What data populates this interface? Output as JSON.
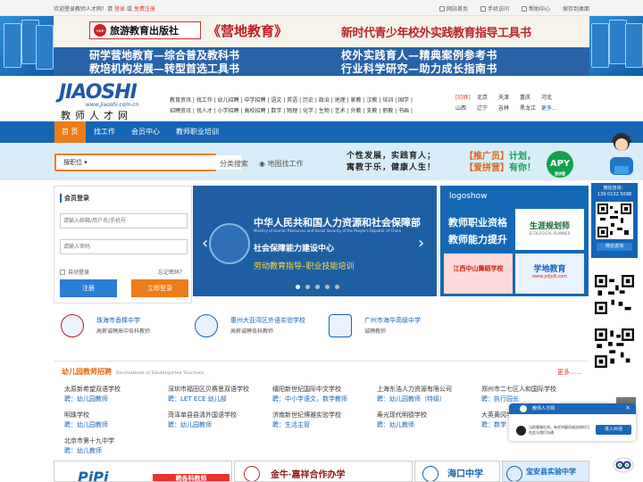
{
  "topbar": {
    "welcome_prefix": "欢迎登录教师人才网！请",
    "login": "登录",
    "or": "或",
    "register": "免费注册",
    "links": [
      "网站首页",
      "手机访问",
      "帮助中心",
      "保存到桌面"
    ]
  },
  "banner": {
    "publisher": "旅游教育出版社",
    "brand": "《营地教育》",
    "slogan": "新时代青少年校外实践教育指导工具书",
    "left_lines": [
      "研学营地教育—综合普及教科书",
      "教培机构发展—转型首选工具书"
    ],
    "right_lines": [
      "校外实践育人—精典案例参考书",
      "行业科学研究—助力成长指南书"
    ]
  },
  "logo": {
    "en": "JIAOSHI",
    "url": "www.jiaoshi.com.cn",
    "cn": "教师人才网"
  },
  "categories": {
    "row1": "教育资讯 | 找工作 | 幼儿招聘 | 中学招聘 | 语文 | 英语 | 历史 | 政治 | 地理 | 家教 | 汉教 | 培训 | 国学 |",
    "row2": "招聘资讯 | 找人才 | 小学招聘 | 高校招聘 | 数学 | 物理 | 化学 | 生物 | 艺术 | 外教 | 支教 | 职教 | 书画 |"
  },
  "cities": {
    "row1": [
      "[切换]",
      "北京",
      "天津",
      "重庆",
      "河北"
    ],
    "row2": [
      "山西",
      "辽宁",
      "吉林",
      "黑龙江",
      "更多..."
    ]
  },
  "nav": [
    "首 页",
    "找工作",
    "会员中心",
    "教师职业培训"
  ],
  "search": {
    "select": "搜职位",
    "placeholder": "",
    "button": "搜索",
    "links": [
      "分类搜索",
      "地图找工作"
    ]
  },
  "slogan": [
    "个性发展，实践育人；",
    "寓教于乐，健康人生！"
  ],
  "promo": {
    "l1_open": "【推广员】",
    "l1_rest": "计划，",
    "l2_open": "【爱拼营】",
    "l2_rest": "有你！",
    "apy": "APY",
    "apy_sub": "爱拼营"
  },
  "login": {
    "title": "会员登录",
    "account_placeholder": "请输入邮箱/用户名/手机号",
    "password_placeholder": "请输入密码",
    "remember": "自动登录",
    "forgot": "忘记密码？",
    "register": "注册",
    "login": "立即登录"
  },
  "slider": {
    "title": "中华人民共和国人力资源和社会保障部",
    "title_en": "Ministry of Human Resources and Social Security of the People's Republic of China",
    "line2": "社会保障能力建设中心",
    "line3": "劳动教育指导–职业技能培训",
    "prev": "‹",
    "next": "›"
  },
  "logoshow": {
    "title": "logoshow",
    "big": [
      "教师职业资格",
      "教师能力提升"
    ],
    "tile1": "生涯规划师",
    "tile1_sub": "ECOLOGICAL PLANNER",
    "tile2": "学地教育",
    "tile2_sub": "www.ydjy8.com",
    "tile3": "江西中山舞蹈学校"
  },
  "schools": [
    {
      "name": "珠海市香樟中学",
      "desc": "高薪诚聘高中各科教师"
    },
    {
      "name": "惠州大亚湾区外语实验学校",
      "desc": "高薪诚聘各科教师"
    },
    {
      "name": "广州市海华高级中学",
      "desc": "诚聘教师"
    }
  ],
  "section": {
    "title": "幼儿园教师招聘",
    "title_en": "Recruitment of Kindergarten Teachers",
    "more": "更多……",
    "jobs": [
      [
        {
          "n": "太原新希望双语学校",
          "p": "聘：幼儿园教师"
        },
        {
          "n": "深圳市福田区贝赛思双语学校",
          "p": "聘：LET ECE 幼儿部"
        },
        {
          "n": "缙阳新世纪国际中文学校",
          "p": "聘：中小学语文，数学教师"
        },
        {
          "n": "上海东浩人力资源有限公司",
          "p": "聘：幼儿园教师（特级）"
        },
        {
          "n": "郑州市二七区人和国际学校",
          "p": "聘：执行园长"
        }
      ],
      [
        {
          "n": "明珠学校",
          "p": "聘：幼儿园教师"
        },
        {
          "n": "菏泽单县县清外国语学校",
          "p": "聘：幼儿园教师"
        },
        {
          "n": "济南新世纪博雅实验学校",
          "p": "聘：生活主管"
        },
        {
          "n": "寿光现代明德学校",
          "p": "聘：幼儿教师"
        },
        {
          "n": "大英黄冈学校",
          "p": "聘：数学"
        }
      ],
      [
        {
          "n": "北京市第十九中学",
          "p": "聘：幼儿教师"
        }
      ]
    ]
  },
  "ads": [
    "PiPi",
    "聘各科教师",
    "金牛·嘉祥合作办学",
    "海口中学",
    "宝安县实验中学"
  ],
  "sidebar": {
    "wx_title": "微信咨询：",
    "phone": "139 0132 5098",
    "wx_btn": "微信咨询"
  },
  "chat": {
    "title": "教师人才网",
    "msg": "当前客服在线，有任何疑问或咨询时可在此与我们沟通",
    "join": "进入对话",
    "close": "×"
  },
  "colors": {
    "brand_blue": "#1565b4",
    "accent_orange": "#eb7d1a",
    "link_red": "#e03d2f",
    "green": "#13a24b"
  }
}
